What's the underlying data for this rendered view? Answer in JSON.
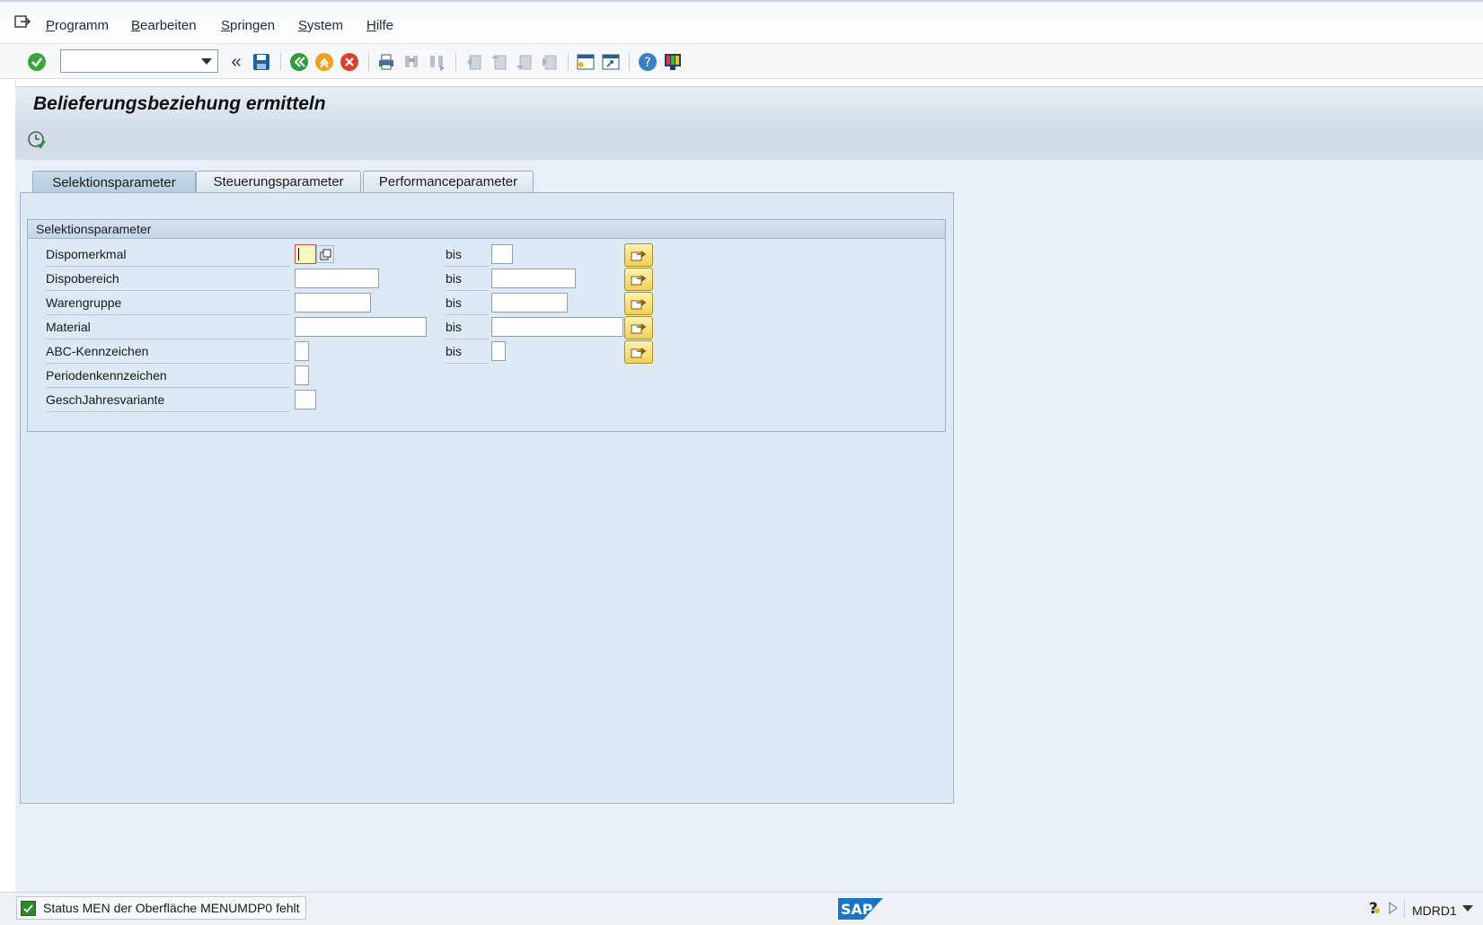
{
  "menubar": {
    "items": [
      {
        "label": "Programm",
        "underline": "P",
        "rest": "rogramm"
      },
      {
        "label": "Bearbeiten",
        "underline": "B",
        "rest": "earbeiten"
      },
      {
        "label": "Springen",
        "underline": "S",
        "rest": "pringen"
      },
      {
        "label": "System",
        "underline": "S",
        "rest": "ystem"
      },
      {
        "label": "Hilfe",
        "underline": "H",
        "rest": "ilfe"
      }
    ]
  },
  "toolbar": {
    "command_value": "",
    "icons": [
      "enter-icon",
      "expand-icon",
      "save-icon",
      "back-icon",
      "exit-icon",
      "cancel-icon",
      "print-icon",
      "find-icon",
      "find-next-icon",
      "first-page-icon",
      "previous-page-icon",
      "next-page-icon",
      "last-page-icon",
      "new-session-icon",
      "shortcut-icon",
      "help-icon",
      "layout-icon"
    ]
  },
  "title": "Belieferungsbeziehung ermitteln",
  "tabs": [
    {
      "label": "Selektionsparameter",
      "active": true
    },
    {
      "label": "Steuerungsparameter",
      "active": false
    },
    {
      "label": "Performanceparameter",
      "active": false
    }
  ],
  "group": {
    "title": "Selektionsparameter",
    "bis_label": "bis",
    "rows": [
      {
        "label": "Dispomerkmal",
        "from": "",
        "to": ""
      },
      {
        "label": "Dispobereich",
        "from": "",
        "to": ""
      },
      {
        "label": "Warengruppe",
        "from": "",
        "to": ""
      },
      {
        "label": "Material",
        "from": "",
        "to": ""
      },
      {
        "label": "ABC-Kennzeichen",
        "from": "",
        "to": ""
      },
      {
        "label": "Periodenkennzeichen",
        "from": ""
      },
      {
        "label": "GeschJahresvariante",
        "from": ""
      }
    ]
  },
  "status": {
    "message": "Status MEN der Oberfläche MENUMDP0 fehlt",
    "system": "MDRD1",
    "logo": "SAP"
  },
  "colors": {
    "accent_green": "#2a8a2a",
    "multi_button": "#f2cf55",
    "panel": "#dde9f4"
  }
}
